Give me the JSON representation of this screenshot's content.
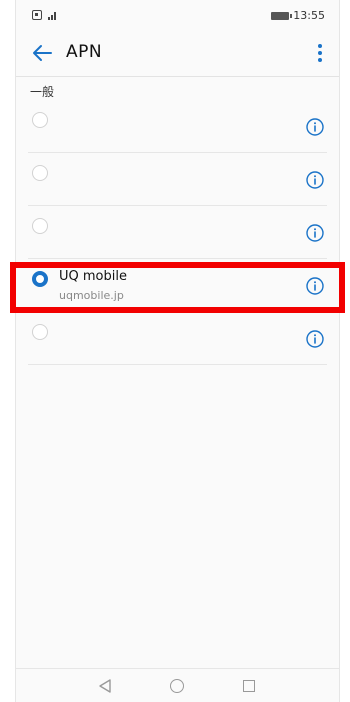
{
  "status_bar": {
    "time": "13:55",
    "icons": [
      "sim-icon",
      "signal-icon",
      "battery-icon"
    ]
  },
  "app_bar": {
    "title": "APN",
    "icons": [
      "back-arrow-icon",
      "more-vert-icon"
    ]
  },
  "section": {
    "label": "一般"
  },
  "apn_list": [
    {
      "name": "",
      "value": "",
      "selected": false
    },
    {
      "name": "",
      "value": "",
      "selected": false
    },
    {
      "name": "",
      "value": "",
      "selected": false
    },
    {
      "name": "UQ mobile",
      "value": "uqmobile.jp",
      "selected": true
    },
    {
      "name": "",
      "value": "",
      "selected": false
    }
  ],
  "colors": {
    "accent": "#1a73c8",
    "highlight": "#f20000",
    "divider": "#e6e6e6"
  },
  "nav_bar": {
    "icons": [
      "nav-back-icon",
      "nav-home-icon",
      "nav-recent-icon"
    ]
  }
}
